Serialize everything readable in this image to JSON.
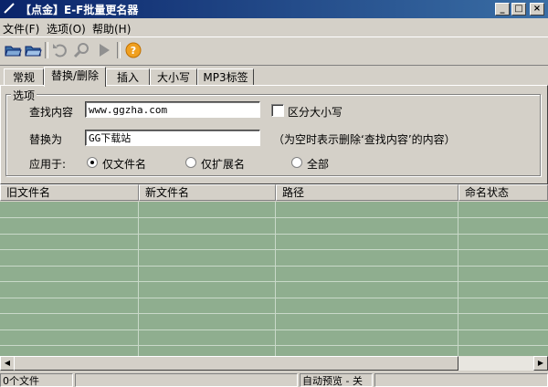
{
  "window": {
    "title": "【点金】E-F批量更名器"
  },
  "menu": [
    {
      "label": "文件(F)"
    },
    {
      "label": "选项(O)"
    },
    {
      "label": "帮助(H)"
    }
  ],
  "toolbar": [
    {
      "icon": "open-folder-icon"
    },
    {
      "icon": "folder-add-icon"
    },
    {
      "icon": "undo-icon"
    },
    {
      "icon": "search-icon"
    },
    {
      "icon": "run-icon"
    },
    {
      "icon": "help-icon"
    }
  ],
  "tabs": [
    {
      "label": "常规",
      "active": false
    },
    {
      "label": "替换/删除",
      "active": true
    },
    {
      "label": "插入",
      "active": false
    },
    {
      "label": "大小写",
      "active": false
    },
    {
      "label": "MP3标签",
      "active": false
    }
  ],
  "options": {
    "legend": "选项",
    "find_label": "查找内容",
    "find_value": "www.ggzha.com",
    "case_label": "区分大小写",
    "case_checked": false,
    "replace_label": "替换为",
    "replace_value": "GG下载站",
    "replace_hint": "（为空时表示删除‘查找内容’的内容）",
    "apply_label": "应用于:",
    "apply_options": [
      {
        "label": "仅文件名",
        "selected": true
      },
      {
        "label": "仅扩展名",
        "selected": false
      },
      {
        "label": "全部",
        "selected": false
      }
    ]
  },
  "table": {
    "columns": [
      "旧文件名",
      "新文件名",
      "路径",
      "命名状态"
    ],
    "rows": []
  },
  "status": {
    "file_count": "0个文件",
    "middle": "",
    "preview": "自动预览 - 关"
  },
  "colors": {
    "grid_bg": "#8fae8f",
    "title_start": "#0a246a",
    "title_end": "#3a6ea5"
  }
}
